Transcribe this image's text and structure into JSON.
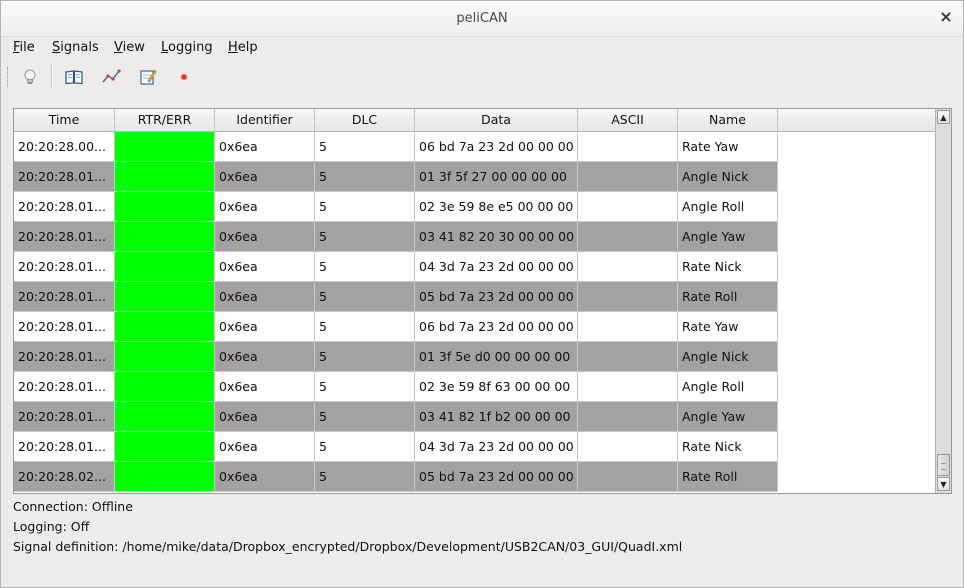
{
  "window": {
    "title": "peliCAN"
  },
  "menu": [
    {
      "mnemonic": "F",
      "rest": "ile"
    },
    {
      "mnemonic": "S",
      "rest": "ignals"
    },
    {
      "mnemonic": "V",
      "rest": "iew"
    },
    {
      "mnemonic": "L",
      "rest": "ogging"
    },
    {
      "mnemonic": "H",
      "rest": "elp"
    }
  ],
  "toolbar": {
    "buttons": [
      "lightbulb-icon",
      "book-icon",
      "graph-icon",
      "edit-icon",
      "record-icon"
    ]
  },
  "colors": {
    "rtr_ok": "#00ff00",
    "row_alt": "#a2a2a4",
    "record_dot": "#e53333"
  },
  "table": {
    "columns": [
      "Time",
      "RTR/ERR",
      "Identifier",
      "DLC",
      "Data",
      "ASCII",
      "Name"
    ],
    "rows": [
      {
        "time": "20:20:28.00...",
        "rtr": "",
        "id": "0x6ea",
        "dlc": "5",
        "data": "06 bd 7a 23 2d 00 00 00",
        "ascii": "",
        "name": "Rate Yaw"
      },
      {
        "time": "20:20:28.01...",
        "rtr": "",
        "id": "0x6ea",
        "dlc": "5",
        "data": "01 3f 5f 27 00 00 00 00",
        "ascii": "",
        "name": "Angle Nick"
      },
      {
        "time": "20:20:28.01...",
        "rtr": "",
        "id": "0x6ea",
        "dlc": "5",
        "data": "02 3e 59 8e e5 00 00 00",
        "ascii": "",
        "name": "Angle Roll"
      },
      {
        "time": "20:20:28.01...",
        "rtr": "",
        "id": "0x6ea",
        "dlc": "5",
        "data": "03 41 82 20 30 00 00 00",
        "ascii": "",
        "name": "Angle Yaw"
      },
      {
        "time": "20:20:28.01...",
        "rtr": "",
        "id": "0x6ea",
        "dlc": "5",
        "data": "04 3d 7a 23 2d 00 00 00",
        "ascii": "",
        "name": "Rate Nick"
      },
      {
        "time": "20:20:28.01...",
        "rtr": "",
        "id": "0x6ea",
        "dlc": "5",
        "data": "05 bd 7a 23 2d 00 00 00",
        "ascii": "",
        "name": "Rate Roll"
      },
      {
        "time": "20:20:28.01...",
        "rtr": "",
        "id": "0x6ea",
        "dlc": "5",
        "data": "06 bd 7a 23 2d 00 00 00",
        "ascii": "",
        "name": "Rate Yaw"
      },
      {
        "time": "20:20:28.01...",
        "rtr": "",
        "id": "0x6ea",
        "dlc": "5",
        "data": "01 3f 5e d0 00 00 00 00",
        "ascii": "",
        "name": "Angle Nick"
      },
      {
        "time": "20:20:28.01...",
        "rtr": "",
        "id": "0x6ea",
        "dlc": "5",
        "data": "02 3e 59 8f 63 00 00 00",
        "ascii": "",
        "name": "Angle Roll"
      },
      {
        "time": "20:20:28.01...",
        "rtr": "",
        "id": "0x6ea",
        "dlc": "5",
        "data": "03 41 82 1f b2 00 00 00",
        "ascii": "",
        "name": "Angle Yaw"
      },
      {
        "time": "20:20:28.01...",
        "rtr": "",
        "id": "0x6ea",
        "dlc": "5",
        "data": "04 3d 7a 23 2d 00 00 00",
        "ascii": "",
        "name": "Rate Nick"
      },
      {
        "time": "20:20:28.02...",
        "rtr": "",
        "id": "0x6ea",
        "dlc": "5",
        "data": "05 bd 7a 23 2d 00 00 00",
        "ascii": "",
        "name": "Rate Roll"
      }
    ]
  },
  "status": {
    "connection": "Connection: Offline",
    "logging": "Logging: Off",
    "signal_definition": "Signal definition: /home/mike/data/Dropbox_encrypted/Dropbox/Development/USB2CAN/03_GUI/QuadI.xml"
  }
}
